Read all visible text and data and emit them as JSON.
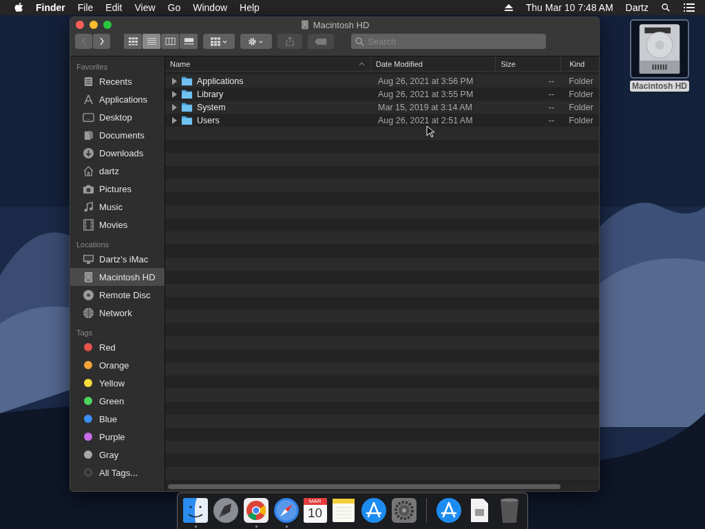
{
  "menu_bar": {
    "app": "Finder",
    "menus": [
      "File",
      "Edit",
      "View",
      "Go",
      "Window",
      "Help"
    ],
    "clock": "Thu Mar 10  7:48 AM",
    "user": "Dartz"
  },
  "window": {
    "title": "Macintosh HD",
    "toolbar": {
      "views": [
        {
          "kind": "icons",
          "selected": false
        },
        {
          "kind": "list",
          "selected": true
        },
        {
          "kind": "columns",
          "selected": false
        },
        {
          "kind": "gallery",
          "selected": false
        }
      ],
      "share_disabled": true,
      "tags_disabled": true,
      "search": {
        "placeholder": "Search"
      }
    },
    "sidebar": [
      {
        "heading": "Favorites",
        "items": [
          {
            "label": "Recents",
            "kind": "recents",
            "selected": false
          },
          {
            "label": "Applications",
            "kind": "apps",
            "selected": false
          },
          {
            "label": "Desktop",
            "kind": "desktop",
            "selected": false
          },
          {
            "label": "Documents",
            "kind": "documents",
            "selected": false
          },
          {
            "label": "Downloads",
            "kind": "downloads",
            "selected": false
          },
          {
            "label": "dartz",
            "kind": "home",
            "selected": false
          },
          {
            "label": "Pictures",
            "kind": "camera",
            "selected": false
          },
          {
            "label": "Music",
            "kind": "music",
            "selected": false
          },
          {
            "label": "Movies",
            "kind": "film",
            "selected": false
          }
        ]
      },
      {
        "heading": "Locations",
        "items": [
          {
            "label": "Dartz’s iMac",
            "kind": "computer",
            "selected": false
          },
          {
            "label": "Macintosh HD",
            "kind": "disk",
            "selected": true
          },
          {
            "label": "Remote Disc",
            "kind": "disc",
            "selected": false
          },
          {
            "label": "Network",
            "kind": "network",
            "selected": false
          }
        ]
      },
      {
        "heading": "Tags",
        "items": [
          {
            "label": "Red",
            "kind": "tag",
            "color": "#e5534b",
            "selected": false
          },
          {
            "label": "Orange",
            "kind": "tag",
            "color": "#f2a33a",
            "selected": false
          },
          {
            "label": "Yellow",
            "kind": "tag",
            "color": "#f5dc3b",
            "selected": false
          },
          {
            "label": "Green",
            "kind": "tag",
            "color": "#4cd65c",
            "selected": false
          },
          {
            "label": "Blue",
            "kind": "tag",
            "color": "#3b8ff5",
            "selected": false
          },
          {
            "label": "Purple",
            "kind": "tag",
            "color": "#c86ce8",
            "selected": false
          },
          {
            "label": "Gray",
            "kind": "tag",
            "color": "#a8a8a8",
            "selected": false
          },
          {
            "label": "All Tags...",
            "kind": "alltags",
            "selected": false
          }
        ]
      }
    ],
    "table": {
      "columns": [
        "Name",
        "Date Modified",
        "Size",
        "Kind"
      ],
      "rows": [
        {
          "name": "Applications",
          "date": "Aug 26, 2021 at 3:56 PM",
          "size": "--",
          "kind": "Folder",
          "expanded": false
        },
        {
          "name": "Library",
          "date": "Aug 26, 2021 at 3:55 PM",
          "size": "--",
          "kind": "Folder",
          "expanded": false
        },
        {
          "name": "System",
          "date": "Mar 15, 2019 at 3:14 AM",
          "size": "--",
          "kind": "Folder",
          "expanded": false
        },
        {
          "name": "Users",
          "date": "Aug 26, 2021 at 2:51 AM",
          "size": "--",
          "kind": "Folder",
          "expanded": false
        }
      ]
    }
  },
  "desktop_icons": [
    {
      "label": "Macintosh HD",
      "selected": true
    }
  ],
  "dock": [
    {
      "kind": "finder",
      "running": true
    },
    {
      "kind": "launchpad",
      "running": false
    },
    {
      "kind": "browser",
      "running": true
    },
    {
      "kind": "compass",
      "running": true
    },
    {
      "kind": "calendar",
      "month": "MAR",
      "day": "10",
      "running": false
    },
    {
      "kind": "notes",
      "running": false
    },
    {
      "kind": "appstore",
      "running": false
    },
    {
      "kind": "settings",
      "running": false
    },
    {
      "kind": "separator"
    },
    {
      "kind": "stack",
      "running": false
    },
    {
      "kind": "document",
      "running": false
    },
    {
      "kind": "trash",
      "running": false
    }
  ]
}
